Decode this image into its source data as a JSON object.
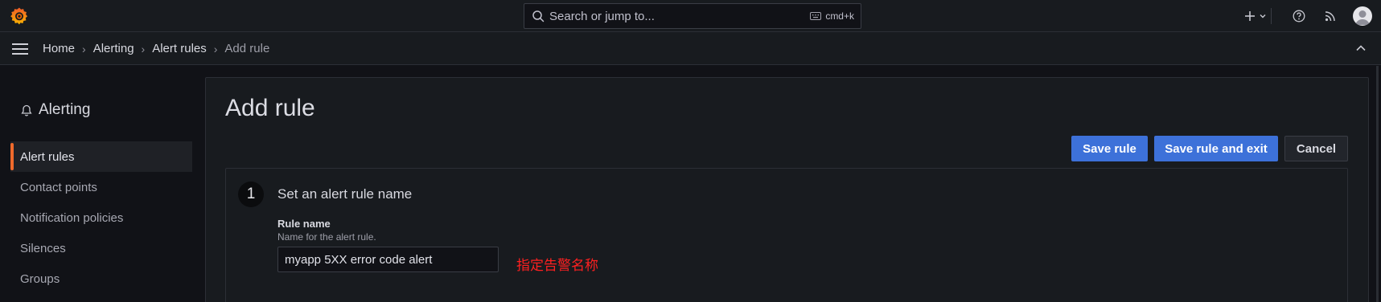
{
  "topbar": {
    "search_placeholder": "Search or jump to...",
    "search_shortcut": "cmd+k",
    "icons": [
      "grafana-logo-icon",
      "search-icon",
      "keyboard-icon",
      "plus-icon",
      "chevron-down-icon",
      "help-icon",
      "rss-icon",
      "avatar"
    ]
  },
  "breadcrumb": {
    "items": [
      "Home",
      "Alerting",
      "Alert rules"
    ],
    "current": "Add rule",
    "separator": "›"
  },
  "sidebar": {
    "title": "Alerting",
    "items": [
      {
        "label": "Alert rules",
        "active": true
      },
      {
        "label": "Contact points",
        "active": false
      },
      {
        "label": "Notification policies",
        "active": false
      },
      {
        "label": "Silences",
        "active": false
      },
      {
        "label": "Groups",
        "active": false
      }
    ]
  },
  "main": {
    "title": "Add rule",
    "buttons": {
      "save": "Save rule",
      "save_exit": "Save rule and exit",
      "cancel": "Cancel"
    },
    "section": {
      "step": "1",
      "title": "Set an alert rule name",
      "field_label": "Rule name",
      "field_description": "Name for the alert rule.",
      "field_value": "myapp 5XX error code alert"
    },
    "annotation": "指定告警名称"
  },
  "colors": {
    "primary": "#3d71d9",
    "active_indicator": "#ef6a2c",
    "annotation": "#ff2020",
    "background": "#111217",
    "panel": "#181b1f"
  }
}
